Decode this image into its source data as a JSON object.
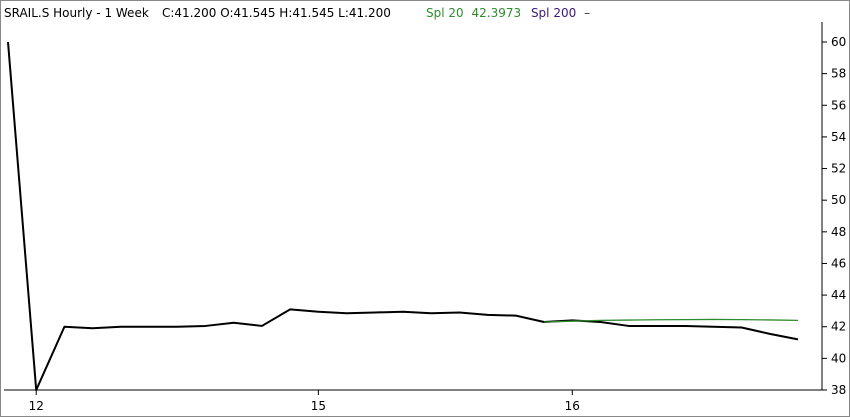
{
  "header": {
    "symbol_text": "SRAIL.S Hourly -  1 Week",
    "ohlc_text": "C:41.200 O:41.545 H:41.545 L:41.200",
    "spl20_label": "Spl 20",
    "spl20_value": "42.3973",
    "spl200_label": "Spl 200",
    "spl200_value": "–"
  },
  "colors": {
    "price": "#000000",
    "spl20": "#2e8b2e",
    "spl200": "#3a1a7a",
    "axis": "#000000",
    "background": "#ffffff"
  },
  "chart_data": {
    "type": "line",
    "ylim": [
      38,
      61
    ],
    "y_ticks": [
      38,
      40,
      42,
      44,
      46,
      48,
      50,
      52,
      54,
      56,
      58,
      60
    ],
    "x_ticks": [
      {
        "label": "12",
        "index": 1
      },
      {
        "label": "15",
        "index": 11
      },
      {
        "label": "16",
        "index": 20
      }
    ],
    "series": [
      {
        "key": "price",
        "values": [
          60.0,
          38.0,
          42.0,
          41.9,
          42.0,
          42.0,
          42.0,
          42.05,
          42.25,
          42.05,
          43.1,
          42.95,
          42.85,
          42.9,
          42.95,
          42.85,
          42.9,
          42.75,
          42.7,
          42.3,
          42.4,
          42.3,
          42.05,
          42.05,
          42.05,
          42.0,
          41.95,
          41.55,
          41.2
        ]
      },
      {
        "key": "spl20",
        "start_index": 19,
        "values": [
          42.3,
          42.35,
          42.4,
          42.42,
          42.44,
          42.45,
          42.46,
          42.45,
          42.43,
          42.4
        ]
      }
    ]
  }
}
